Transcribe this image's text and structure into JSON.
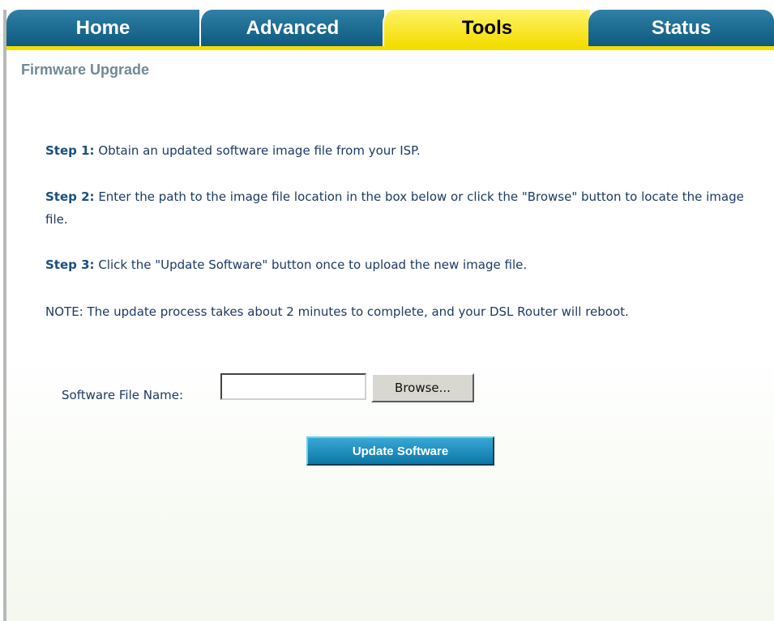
{
  "nav": {
    "tabs": [
      {
        "label": "Home"
      },
      {
        "label": "Advanced"
      },
      {
        "label": "Tools"
      },
      {
        "label": "Status"
      }
    ],
    "active": "Tools"
  },
  "page": {
    "title": "Firmware Upgrade"
  },
  "steps": {
    "step1_label": "Step 1:",
    "step1_text": " Obtain an updated software image file from your ISP.",
    "step2_label": "Step 2:",
    "step2_text": " Enter the path to the image file location in the box below or click the \"Browse\" button to locate the image file.",
    "step3_label": "Step 3:",
    "step3_text": " Click the \"Update Software\" button once to upload the new image file.",
    "note": "NOTE: The update process takes about 2 minutes to complete, and your DSL Router will reboot."
  },
  "form": {
    "file_label": "Software File Name:",
    "file_value": "",
    "browse_label": "Browse...",
    "update_label": "Update Software"
  },
  "colors": {
    "tab_blue": "#0e5a80",
    "tab_active_yellow": "#f4dd00",
    "text_blue": "#1c3a66",
    "title_gray": "#6f8a96"
  }
}
